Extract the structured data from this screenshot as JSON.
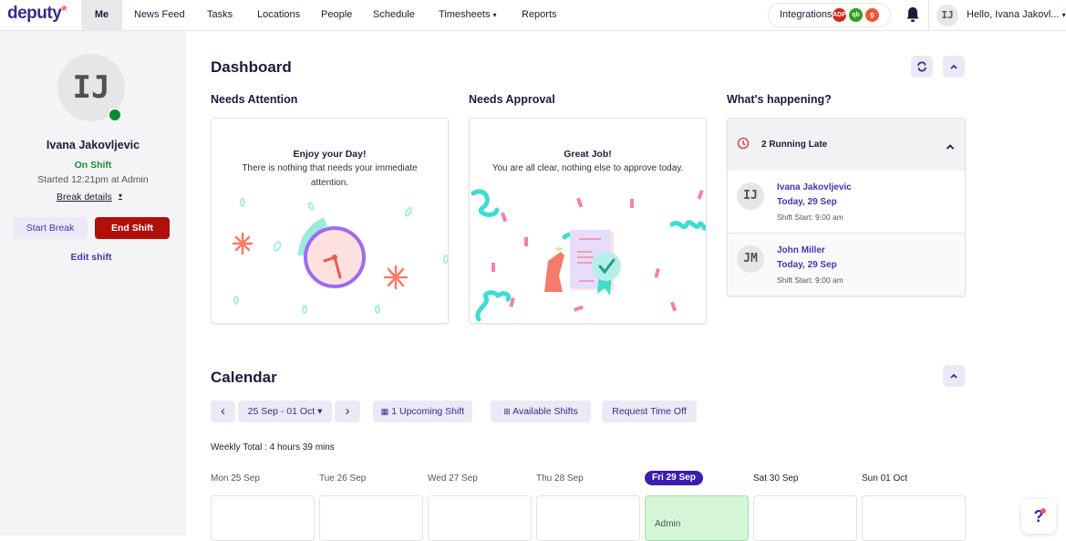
{
  "brand": {
    "name": "deputy",
    "accent": "#3b2a8e",
    "star": "*"
  },
  "nav": {
    "items": [
      {
        "label": "Me",
        "active": true
      },
      {
        "label": "News Feed"
      },
      {
        "label": "Tasks"
      },
      {
        "label": "Locations"
      },
      {
        "label": "People"
      },
      {
        "label": "Schedule"
      },
      {
        "label": "Timesheets",
        "dropdown": true
      },
      {
        "label": "Reports"
      }
    ],
    "integrations": {
      "label": "Integrations",
      "badges": [
        {
          "text": "ADP",
          "color": "#d0271d"
        },
        {
          "text": "qb",
          "color": "#2ca01c"
        },
        {
          "text": "g",
          "color": "#f05537"
        }
      ]
    },
    "bell_icon": "bell-icon",
    "user": {
      "initials": "IJ",
      "greeting": "Hello, Ivana Jakovl...",
      "caret": "▾"
    }
  },
  "sidebar": {
    "initials": "IJ",
    "name": "Ivana Jakovljevic",
    "status": "On Shift",
    "started": "Started 12:21pm at Admin",
    "break_details": "Break details",
    "break_caret": "▾",
    "start_break": "Start Break",
    "end_shift": "End Shift",
    "edit_shift": "Edit shift"
  },
  "dashboard": {
    "title": "Dashboard",
    "refresh_icon": "⟳",
    "collapse_icon": "⌃",
    "needs_attention": {
      "title": "Needs Attention",
      "card_title": "Enjoy your Day!",
      "card_text": "There is nothing that needs your immediate attention."
    },
    "needs_approval": {
      "title": "Needs Approval",
      "card_title": "Great Job!",
      "card_text": "You are all clear, nothing else to approve today."
    },
    "happening": {
      "title": "What's happening?",
      "group_label": "2 Running Late",
      "items": [
        {
          "initials": "IJ",
          "name": "Ivana Jakovljevic",
          "date": "Today, 29 Sep",
          "shift": "Shift Start: 9:00 am"
        },
        {
          "initials": "JM",
          "name": "John Miller",
          "date": "Today, 29 Sep",
          "shift": "Shift Start: 9:00 am"
        }
      ]
    }
  },
  "calendar": {
    "title": "Calendar",
    "prev": "‹",
    "next": "›",
    "range": "25 Sep - 01 Oct ▾",
    "upcoming": "1 Upcoming Shift",
    "available": "Available Shifts",
    "time_off": "Request Time Off",
    "weekly_total": "Weekly Total : 4 hours 39 mins",
    "days": [
      {
        "label": "Mon 25 Sep",
        "shift": ""
      },
      {
        "label": "Tue 26 Sep",
        "shift": ""
      },
      {
        "label": "Wed 27 Sep",
        "shift": ""
      },
      {
        "label": "Thu 28 Sep",
        "shift": ""
      },
      {
        "label": "Fri 29 Sep",
        "shift": "Admin",
        "today": true
      },
      {
        "label": "Sat 30 Sep",
        "shift": ""
      },
      {
        "label": "Sun 01 Oct",
        "shift": ""
      }
    ]
  },
  "help": {
    "label": "?"
  }
}
